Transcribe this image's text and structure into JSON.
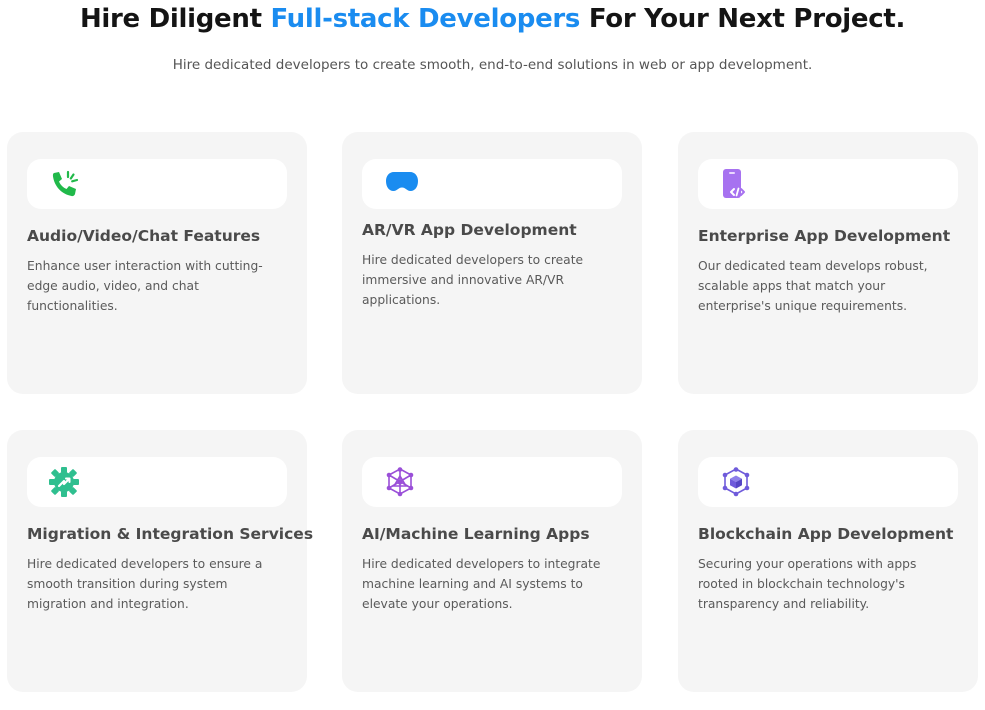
{
  "hero": {
    "title_prefix": "Hire Diligent ",
    "title_accent": "Full-stack Developers",
    "title_suffix": " For Your Next Project.",
    "subtitle": "Hire dedicated developers to create smooth, end-to-end solutions in web or app development.",
    "accent_color": "#1a8cf0"
  },
  "cards": [
    {
      "icon": "phone-icon",
      "icon_color": "#21b94a",
      "title": "Audio/Video/Chat Features",
      "text": "Enhance user interaction with cutting-edge audio, video, and chat functionalities."
    },
    {
      "icon": "vr-headset-icon",
      "icon_color": "#1a8cf0",
      "title": "AR/VR App Development",
      "text": "Hire dedicated developers to create immersive and innovative AR/VR applications."
    },
    {
      "icon": "mobile-code-icon",
      "icon_color": "#a772f0",
      "title": "Enterprise App Development",
      "text": "Our dedicated team develops robust, scalable apps that match your enterprise's unique requirements."
    },
    {
      "icon": "gear-sync-icon",
      "icon_color": "#2fbf8f",
      "title": "Migration & Integration Services",
      "text": "Hire dedicated developers to ensure a smooth transition during system migration and integration."
    },
    {
      "icon": "neural-network-icon",
      "icon_color": "#9a4fd8",
      "title": "AI/Machine Learning Apps",
      "text": "Hire dedicated developers to integrate machine learning and AI systems to elevate your operations."
    },
    {
      "icon": "blockchain-cube-icon",
      "icon_color": "#6f5bdb",
      "title": "Blockchain App Development",
      "text": "Securing your operations with apps rooted in blockchain technology's transparency and reliability."
    }
  ]
}
